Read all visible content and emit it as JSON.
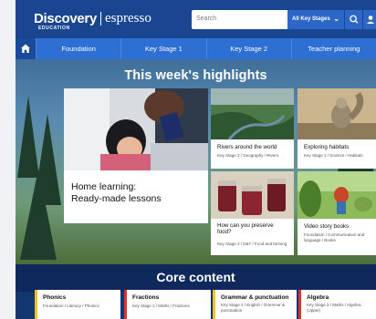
{
  "header": {
    "logo_main": "Discovery",
    "logo_sub": "EDUCATION",
    "logo_product": "espresso",
    "search_placeholder": "Search",
    "stage_select": "All Key Stages",
    "search_icon": "search-icon",
    "user_icon": "user-icon"
  },
  "nav": {
    "home_icon": "home-icon",
    "items": [
      "Foundation",
      "Key Stage 1",
      "Key Stage 2",
      "Teacher planning"
    ]
  },
  "hero": {
    "title": "This week's highlights",
    "big_card": {
      "title_line1": "Home learning:",
      "title_line2": "Ready-made lessons"
    },
    "cards": [
      {
        "title": "Rivers around the world",
        "meta": "Key Stage 2 / Geography / Rivers"
      },
      {
        "title": "Exploring habitats",
        "meta": "Key Stage 1 / Science / Habitats"
      },
      {
        "title_line1": "How can you preserve",
        "title_line2": "food?",
        "meta": "Key Stage 2 / D&T / Food and farming"
      },
      {
        "title": "Video story books",
        "meta_line1": "Foundation / Communication and",
        "meta_line2": "language / Books"
      }
    ]
  },
  "core": {
    "title": "Core content",
    "cards": [
      {
        "title": "Phonics",
        "meta": "Foundation / Literacy / Phonics",
        "accent": "#f2c21b"
      },
      {
        "title": "Fractions",
        "meta": "Key Stage 1 / Maths / Fractions",
        "accent": "#e0322a"
      },
      {
        "title": "Grammar & punctuation",
        "meta_line1": "Key Stage 2 / English / Grammar &",
        "meta_line2": "punctuation",
        "accent": "#f2c21b"
      },
      {
        "title": "Algebra",
        "meta_line1": "Key Stage 2 / Maths / Algebra",
        "meta_line2": "(Upper)",
        "accent": "#e0322a"
      }
    ]
  },
  "colors": {
    "topbar": "#1a4590",
    "nav": "#2d6fd2",
    "core_bar": "#10295c"
  }
}
